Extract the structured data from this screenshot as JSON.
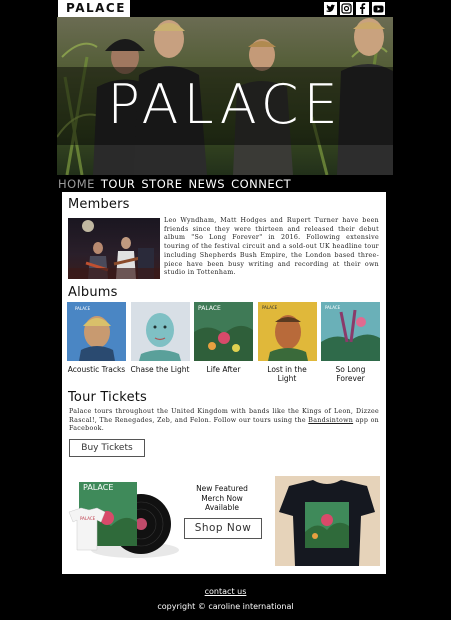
{
  "header": {
    "logo": "PALACE",
    "social_icons": [
      "twitter-icon",
      "instagram-icon",
      "facebook-icon",
      "youtube-icon"
    ]
  },
  "hero": {
    "title": "PALACE"
  },
  "nav": {
    "items": [
      "HOME",
      "TOUR",
      "STORE",
      "NEWS",
      "CONNECT"
    ],
    "active": "HOME"
  },
  "members": {
    "heading": "Members",
    "text": "Leo Wyndham, Matt Hodges and Rupert Turner have been friends since they were thirteen and released their debut album \"So Long Forever\" in 2016. Following extensive touring of the festival circuit and a sold-out UK headline tour including Shepherds Bush Empire, the London based three-piece have been busy writing and recording at their own studio in Tottenham."
  },
  "albums": {
    "heading": "Albums",
    "items": [
      {
        "title": "Acoustic Tracks"
      },
      {
        "title": "Chase the Light"
      },
      {
        "title": "Life After"
      },
      {
        "title": "Lost in the Light"
      },
      {
        "title": "So Long Forever"
      }
    ]
  },
  "tour": {
    "heading": "Tour Tickets",
    "text_before": "Palace tours throughout the United Kingdom with bands like the Kings of Leon, Dizzee Rascal!, The Renegades, Zeb, and Felon. Follow our tours using the ",
    "link": "Bandsintown",
    "text_after": " app on Facebook.",
    "button": "Buy Tickets"
  },
  "merch": {
    "line1": "New Featured",
    "line2": "Merch Now",
    "line3": "Available",
    "button": "Shop Now",
    "vinyl_label": "PALACE",
    "shirt_label": "PALACE"
  },
  "footer": {
    "contact": "contact us",
    "copyright": "copyright © caroline international"
  },
  "colors": {
    "background": "#000000",
    "panel": "#ffffff",
    "nav_active": "#9a9a9a"
  }
}
